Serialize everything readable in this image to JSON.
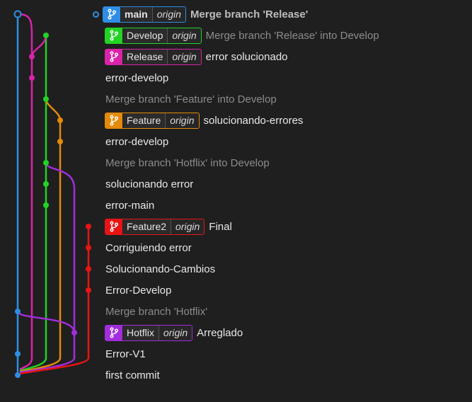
{
  "colors": {
    "main": "#2e8ee6",
    "develop": "#22d324",
    "release": "#d923a8",
    "feature": "#e48a0a",
    "feature2": "#e81414",
    "hotflix": "#a12ddc",
    "background": "#1f1f1f"
  },
  "commits": [
    {
      "message": "Merge branch 'Release'",
      "style": "bold",
      "branch": "main",
      "remote": "origin",
      "branch_color": "#2e8ee6",
      "head": true
    },
    {
      "message": "Merge branch 'Release' into Develop",
      "style": "dim",
      "branch": "Develop",
      "remote": "origin",
      "branch_color": "#22d324"
    },
    {
      "message": "error solucionado",
      "style": "normal",
      "branch": "Release",
      "remote": "origin",
      "branch_color": "#d923a8"
    },
    {
      "message": "error-develop",
      "style": "normal"
    },
    {
      "message": "Merge branch 'Feature' into Develop",
      "style": "dim"
    },
    {
      "message": "solucionando-errores",
      "style": "normal",
      "branch": "Feature",
      "remote": "origin",
      "branch_color": "#e48a0a"
    },
    {
      "message": "error-develop",
      "style": "normal"
    },
    {
      "message": "Merge branch 'Hotflix' into Develop",
      "style": "dim"
    },
    {
      "message": "solucionando error",
      "style": "normal"
    },
    {
      "message": "error-main",
      "style": "normal"
    },
    {
      "message": "Final",
      "style": "normal",
      "branch": "Feature2",
      "remote": "origin",
      "branch_color": "#e81414"
    },
    {
      "message": "Corriguiendo error",
      "style": "normal"
    },
    {
      "message": "Solucionando-Cambios",
      "style": "normal"
    },
    {
      "message": "Error-Develop",
      "style": "normal"
    },
    {
      "message": "Merge branch 'Hotflix'",
      "style": "dim"
    },
    {
      "message": "Arreglado",
      "style": "normal",
      "branch": "Hotflix",
      "remote": "origin",
      "branch_color": "#a12ddc"
    },
    {
      "message": "Error-V1",
      "style": "normal"
    },
    {
      "message": "first commit",
      "style": "normal"
    }
  ],
  "icons": {
    "branch": "git-branch-icon",
    "head": "head-circle-icon"
  }
}
